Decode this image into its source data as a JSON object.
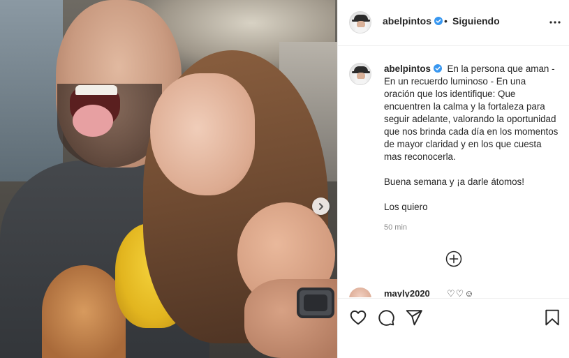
{
  "post": {
    "username": "abelpintos",
    "verified": true,
    "separator": "•",
    "follow_status": "Siguiendo",
    "more_icon": "ellipsis-icon"
  },
  "caption": {
    "username": "abelpintos",
    "paragraph1": "En la persona que aman - En un recuerdo luminoso - En una oración que los identifique: Que encuentren la calma y la fortaleza para seguir adelante, valorando la oportunidad que nos brinda cada día en los momentos de mayor claridad y en los que cuesta mas reconocerla.",
    "paragraph2": "Buena semana y ¡a darle átomos!",
    "paragraph3": "Los quiero",
    "time": "50 min"
  },
  "comment_peek": {
    "username": "mayly2020",
    "text": "♡♡☺"
  },
  "icons": {
    "next": "chevron-right-icon",
    "load_more": "plus-circle-icon",
    "like": "heart-icon",
    "comment": "comment-icon",
    "share": "send-icon",
    "save": "bookmark-icon",
    "verified": "verified-badge-icon"
  },
  "colors": {
    "verified_blue": "#3897f0",
    "text": "#262626",
    "muted": "#8e8e8e",
    "border": "#efefef"
  }
}
